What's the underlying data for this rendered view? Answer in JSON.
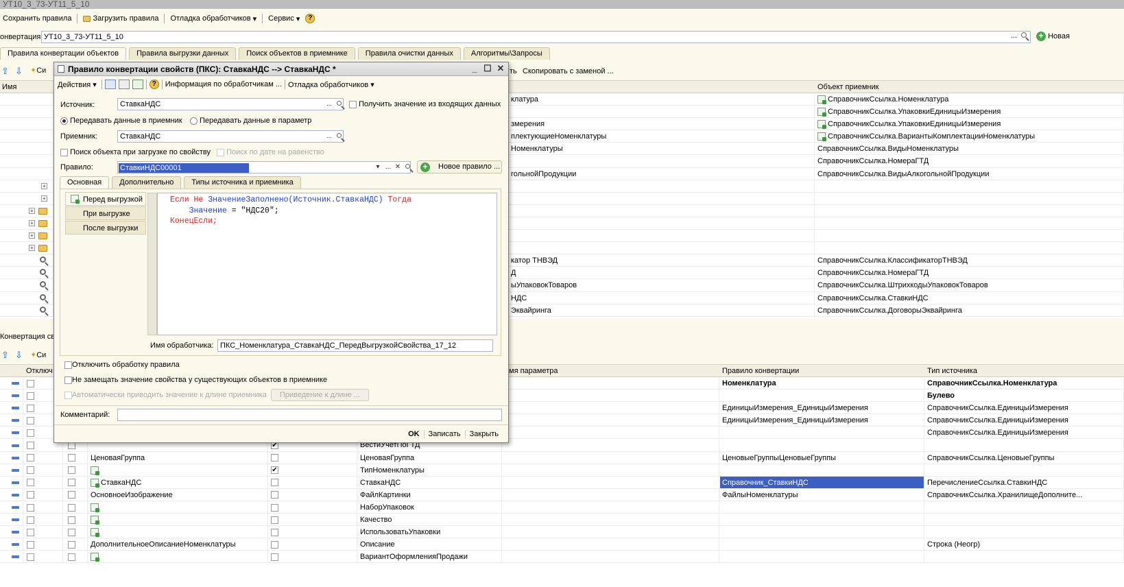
{
  "window": {
    "title": "УТ10_3_73-УТ11_5_10"
  },
  "toolbar": {
    "save": "Сохранить правила",
    "load": "Загрузить правила",
    "debug": "Отладка обработчиков",
    "service": "Сервис"
  },
  "conversion": {
    "label": "онвертация:",
    "value": "УТ10_3_73-УТ11_5_10",
    "new_btn": "Новая"
  },
  "main_tabs": [
    "Правила конвертации объектов",
    "Правила выгрузки данных",
    "Поиск объектов в приемнике",
    "Правила очистки данных",
    "Алгоритмы\\Запросы"
  ],
  "upper_toolbar": {
    "sync": "Си",
    "copy_replace": "Скопировать с заменой ...",
    "th": "ть"
  },
  "upper_grid": {
    "col_name": "Имя",
    "col_receiver": "Объект приемник",
    "rows": [
      {
        "mid": "клатура",
        "recv": "СправочникСсылка.Номенклатура",
        "icon": true
      },
      {
        "mid": "",
        "recv": "СправочникСсылка.УпаковкиЕдиницыИзмерения",
        "icon": true
      },
      {
        "mid": "змерения",
        "recv": "СправочникСсылка.УпаковкиЕдиницыИзмерения",
        "icon": true
      },
      {
        "mid": "плектующиеНоменклатуры",
        "recv": "СправочникСсылка.ВариантыКомплектацииНоменклатуры",
        "icon": true
      },
      {
        "mid": "Номенклатуры",
        "recv": "СправочникСсылка.ВидыНоменклатуры",
        "icon": false
      },
      {
        "mid": "",
        "recv": "СправочникСсылка.НомераГТД",
        "icon": false
      },
      {
        "mid": "гольнойПродукции",
        "recv": "СправочникСсылка.ВидыАлкогольнойПродукции",
        "icon": false
      },
      {
        "mid": "",
        "recv": "",
        "icon": false
      },
      {
        "mid": "",
        "recv": "",
        "icon": false
      },
      {
        "mid": "",
        "recv": "",
        "icon": false
      },
      {
        "mid": "",
        "recv": "",
        "icon": false
      },
      {
        "mid": "",
        "recv": "",
        "icon": false
      },
      {
        "mid": "",
        "recv": "",
        "icon": false
      },
      {
        "mid": "катор ТНВЭД",
        "recv": "СправочникСсылка.КлассификаторТНВЭД",
        "icon": false
      },
      {
        "mid": "Д",
        "recv": "СправочникСсылка.НомераГТД",
        "icon": false
      },
      {
        "mid": "ыУпаковокТоваров",
        "recv": "СправочникСсылка.ШтрихкодыУпаковокТоваров",
        "icon": false
      },
      {
        "mid": "НДС",
        "recv": "СправочникСсылка.СтавкиНДС",
        "icon": false
      },
      {
        "mid": "Эквайринга",
        "recv": "СправочникСсылка.ДоговорыЭквайринга",
        "icon": false
      }
    ]
  },
  "lower_section": {
    "title": "Конвертация св",
    "sync": "Си",
    "col_off": "Отключ",
    "col_param": "мя параметра",
    "col_rule": "Правило конвертации",
    "col_type": "Тип источника",
    "rows": [
      {
        "src": "",
        "chk": false,
        "dst": "",
        "rule": "Номенклатура",
        "type": "СправочникСсылка.Номенклатура",
        "bold": true
      },
      {
        "src": "",
        "chk": false,
        "dst": "",
        "rule": "",
        "type": "Булево",
        "bold": true
      },
      {
        "src": "",
        "chk": false,
        "dst": "",
        "rule": "ЕдиницыИзмерения_ЕдиницыИзмерения",
        "type": "СправочникСсылка.ЕдиницыИзмерения",
        "bold": false
      },
      {
        "src": "",
        "chk": false,
        "dst": "",
        "rule": "ЕдиницыИзмерения_ЕдиницыИзмерения",
        "type": "СправочникСсылка.ЕдиницыИзмерения",
        "bold": false
      },
      {
        "src": "",
        "chk": false,
        "dst": "",
        "rule": "",
        "type": "СправочникСсылка.ЕдиницыИзмерения",
        "bold": false
      },
      {
        "src": "",
        "chk": true,
        "dst": "ВестиУчетПоГТД",
        "rule": "",
        "type": "",
        "bold": false
      },
      {
        "src": "ЦеноваяГруппа",
        "chk": false,
        "dst": "ЦеноваяГруппа",
        "rule": "ЦеновыеГруппыЦеновыеГруппы",
        "type": "СправочникСсылка.ЦеновыеГруппы",
        "bold": false
      },
      {
        "src": "",
        "chk": true,
        "dst": "ТипНоменклатуры",
        "rule": "",
        "type": "",
        "bold": false,
        "icon": true
      },
      {
        "src": "СтавкаНДС",
        "chk": false,
        "dst": "СтавкаНДС",
        "rule": "Справочник_СтавкиНДС",
        "type": "ПеречислениеСсылка.СтавкиНДС",
        "bold": false,
        "icon": true,
        "selected": true
      },
      {
        "src": "ОсновноеИзображение",
        "chk": false,
        "dst": "ФайлКартинки",
        "rule": "ФайлыНоменклатуры",
        "type": "СправочникСсылка.ХранилищеДополните...",
        "bold": false
      },
      {
        "src": "",
        "chk": false,
        "dst": "НаборУпаковок",
        "rule": "",
        "type": "",
        "bold": false,
        "icon": true
      },
      {
        "src": "",
        "chk": false,
        "dst": "Качество",
        "rule": "",
        "type": "",
        "bold": false,
        "icon": true
      },
      {
        "src": "",
        "chk": false,
        "dst": "ИспользоватьУпаковки",
        "rule": "",
        "type": "",
        "bold": false,
        "icon": true
      },
      {
        "src": "ДополнительноеОписаниеНоменклатуры",
        "chk": false,
        "dst": "Описание",
        "rule": "",
        "type": "Строка (Неогр)",
        "bold": false
      },
      {
        "src": "",
        "chk": false,
        "dst": "ВариантОформленияПродажи",
        "rule": "",
        "type": "",
        "bold": false,
        "icon": true
      }
    ]
  },
  "dialog": {
    "title": "Правило конвертации свойств (ПКС): СтавкаНДС --> СтавкаНДС *",
    "actions": "Действия",
    "info": "Информация по обработчикам ...",
    "debug": "Отладка обработчиков",
    "source_label": "Источник:",
    "source_value": "СтавкаНДС",
    "get_from_incoming": "Получить значение из входящих данных",
    "radio_receiver": "Передавать данные в приемник",
    "radio_param": "Передавать данные в параметр",
    "receiver_label": "Приемник:",
    "receiver_value": "СтавкаНДС",
    "search_on_load": "Поиск объекта при загрузке по свойству",
    "search_date": "Поиск по дате на равенство",
    "rule_label": "Правило:",
    "rule_value": "СтавкиНДС00001",
    "new_rule": "Новое правило ...",
    "tabs": [
      "Основная",
      "Дополнительно",
      "Типы источника и приемника"
    ],
    "events": [
      "Перед выгрузкой",
      "При выгрузке",
      "После выгрузки"
    ],
    "code": {
      "l1a": "Если Не ",
      "l1b": "ЗначениеЗаполнено",
      "l1c": "(Источник.СтавкаНДС) ",
      "l1d": "Тогда",
      "l2a": "    Значение",
      "l2b": " = \"НДС20\";",
      "l3": "КонецЕсли;"
    },
    "handler_label": "Имя обработчика:",
    "handler_value": "ПКС_Номенклатура_СтавкаНДС_ПередВыгрузкойСвойства_17_12",
    "disable_rule": "Отключить обработку правила",
    "not_replace": "Не замещать значение свойства у существующих объектов в приемнике",
    "auto_cast": "Автоматически приводить значение к длине приемника",
    "cast_btn": "Приведение к длине ...",
    "comment_label": "Комментарий:",
    "ok": "OK",
    "write": "Записать",
    "close": "Закрыть"
  }
}
